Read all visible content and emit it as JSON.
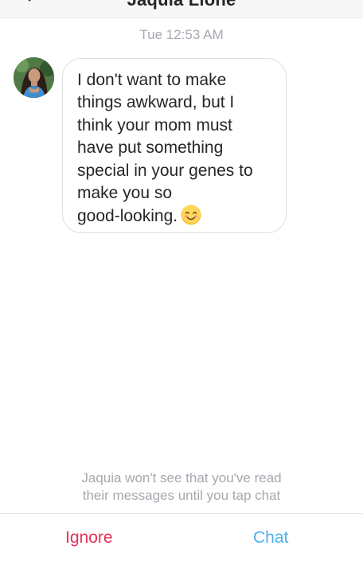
{
  "header": {
    "title": "Jaquia Lione",
    "back_icon": "chevron-left-icon"
  },
  "conversation": {
    "timestamp": "Tue 12:53 AM",
    "message": {
      "text": "I don't want to make\nthings awkward, but I\nthink your mom must\nhave put something\nspecial in your genes to\nmake you so\ngood-looking.",
      "emoji": "smiling-face-emoji"
    }
  },
  "request_notice": "Jaquia won't see that you've read\ntheir messages until you tap chat",
  "actions": {
    "ignore_label": "Ignore",
    "chat_label": "Chat"
  },
  "colors": {
    "ignore": "#e8325a",
    "chat": "#4fb0ef",
    "meta_text": "#a7a7b0",
    "bubble_border": "#dedede"
  }
}
